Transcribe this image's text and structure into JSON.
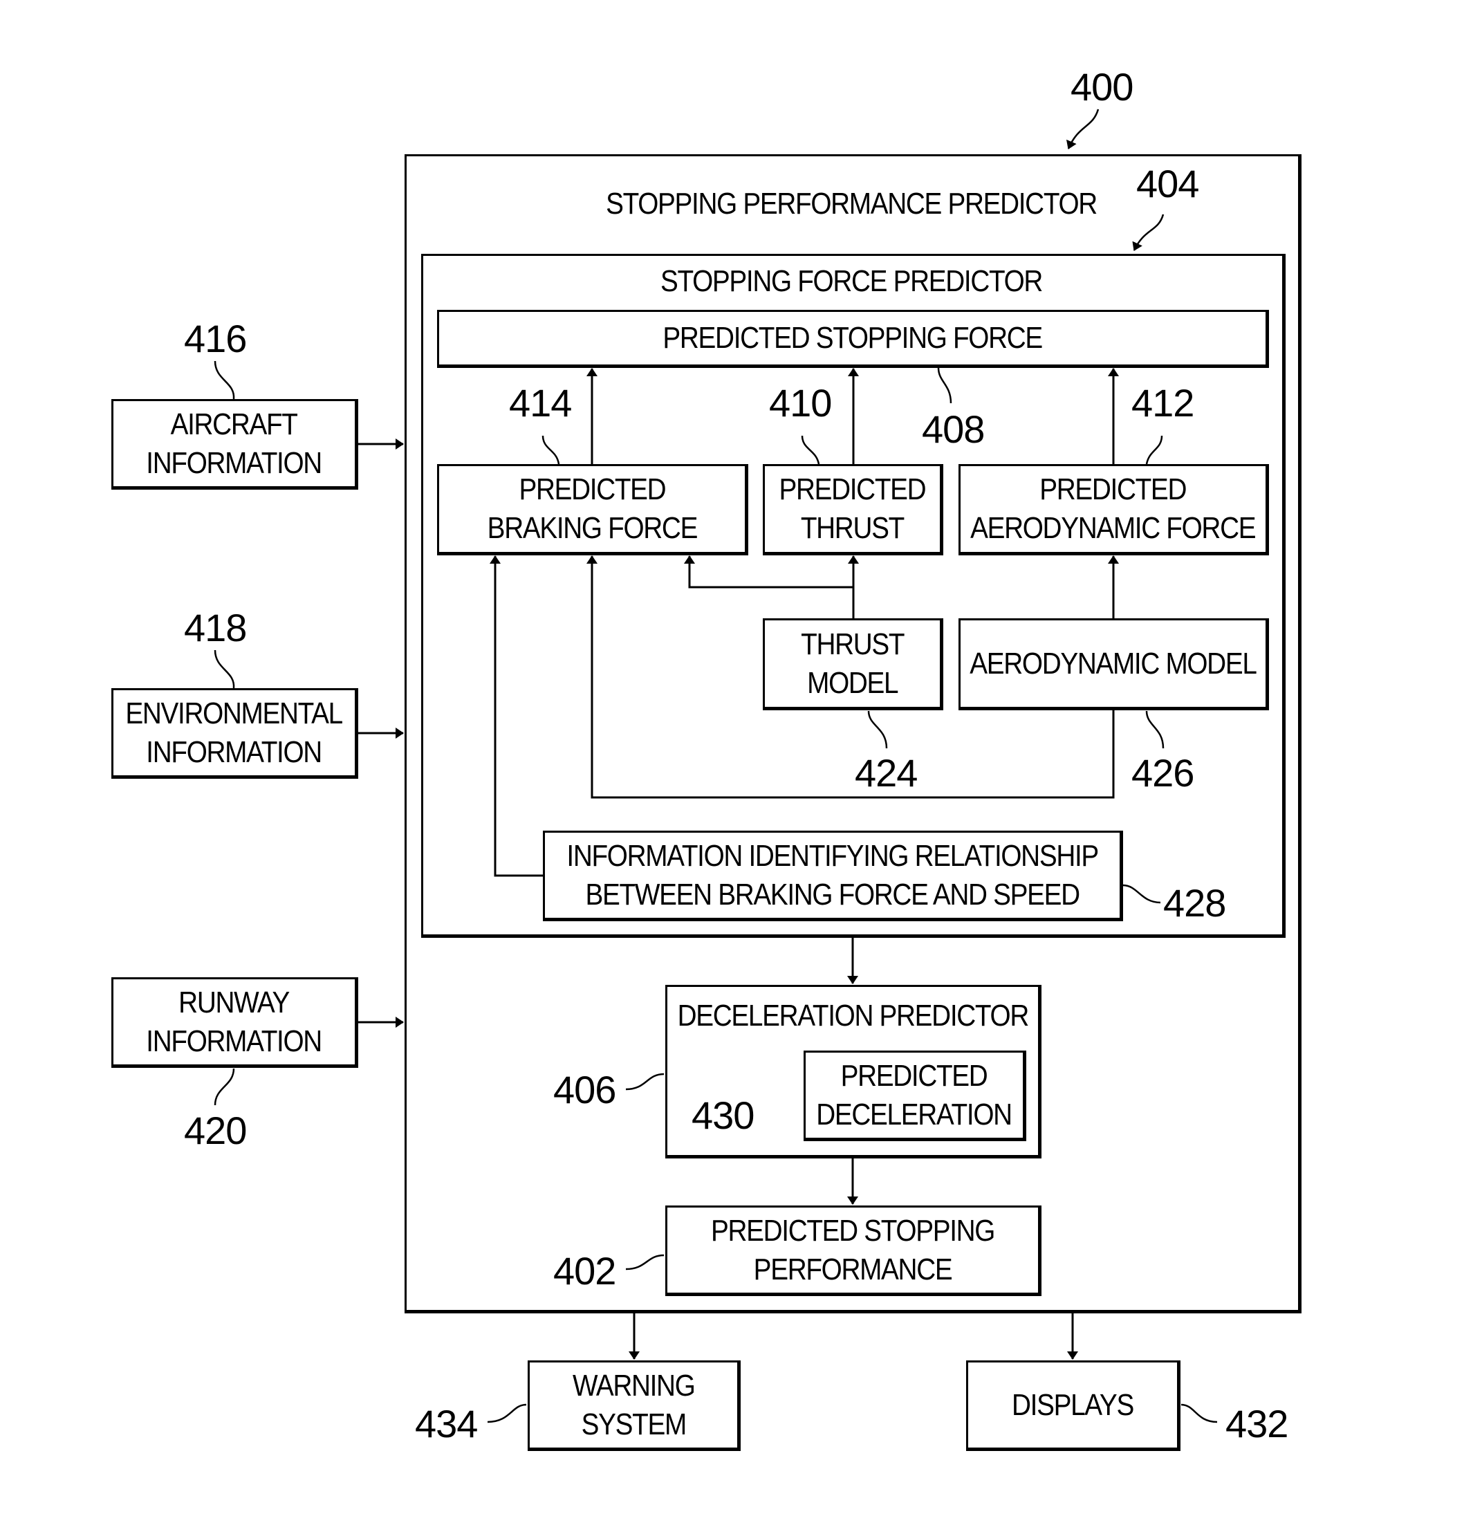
{
  "figure": {
    "ref": "400",
    "outer_title": "STOPPING PERFORMANCE PREDICTOR",
    "inner_ref": "404",
    "inner_title": "STOPPING FORCE PREDICTOR"
  },
  "inputs": [
    {
      "ref": "416",
      "lines": [
        "AIRCRAFT",
        "INFORMATION"
      ]
    },
    {
      "ref": "418",
      "lines": [
        "ENVIRONMENTAL",
        "INFORMATION"
      ]
    },
    {
      "ref": "420",
      "lines": [
        "RUNWAY",
        "INFORMATION"
      ]
    }
  ],
  "blocks": {
    "stopping_force": {
      "ref": "408",
      "lines": [
        "PREDICTED STOPPING FORCE"
      ]
    },
    "braking_force": {
      "ref": "414",
      "lines": [
        "PREDICTED",
        "BRAKING FORCE"
      ]
    },
    "thrust": {
      "ref": "410",
      "lines": [
        "PREDICTED",
        "THRUST"
      ]
    },
    "aero_force": {
      "ref": "412",
      "lines": [
        "PREDICTED",
        "AERODYNAMIC FORCE"
      ]
    },
    "thrust_model": {
      "ref": "424",
      "lines": [
        "THRUST",
        "MODEL"
      ]
    },
    "aero_model": {
      "ref": "426",
      "lines": [
        "AERODYNAMIC MODEL"
      ]
    },
    "relationship": {
      "ref": "428",
      "lines": [
        "INFORMATION IDENTIFYING RELATIONSHIP",
        "BETWEEN BRAKING FORCE AND SPEED"
      ]
    },
    "decel_predictor": {
      "ref": "406",
      "lines": [
        "DECELERATION PREDICTOR"
      ]
    },
    "predicted_decel": {
      "ref": "430",
      "lines": [
        "PREDICTED",
        "DECELERATION"
      ]
    },
    "stopping_performance": {
      "ref": "402",
      "lines": [
        "PREDICTED STOPPING",
        "PERFORMANCE"
      ]
    }
  },
  "outputs": [
    {
      "ref": "434",
      "lines": [
        "WARNING",
        "SYSTEM"
      ]
    },
    {
      "ref": "432",
      "lines": [
        "DISPLAYS"
      ]
    }
  ]
}
